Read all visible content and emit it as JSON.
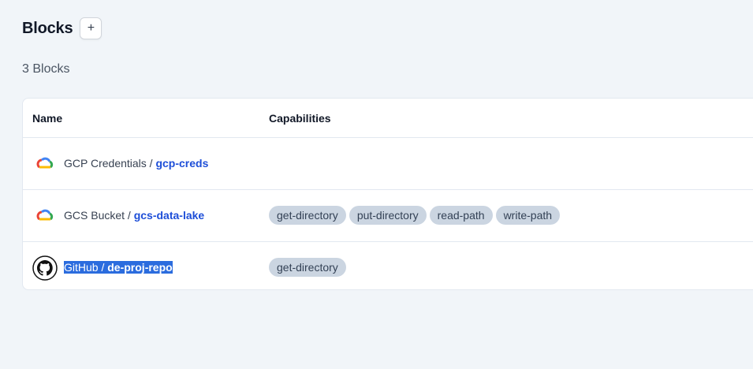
{
  "header": {
    "title": "Blocks",
    "add_label": "+"
  },
  "count_text": "3 Blocks",
  "table": {
    "columns": [
      "Name",
      "Capabilities"
    ],
    "rows": [
      {
        "logo": "google-cloud-icon",
        "type": "GCP Credentials",
        "separator": " / ",
        "slug": "gcp-creds",
        "capabilities": []
      },
      {
        "logo": "google-cloud-icon",
        "type": "GCS Bucket",
        "separator": " / ",
        "slug": "gcs-data-lake",
        "capabilities": [
          "get-directory",
          "put-directory",
          "read-path",
          "write-path"
        ]
      },
      {
        "logo": "github-icon",
        "type": "GitHub",
        "separator": " / ",
        "slug": "de-proj-repo",
        "capabilities": [
          "get-directory"
        ],
        "selected": true
      }
    ]
  },
  "colors": {
    "background": "#f1f5f9",
    "link": "#1d4ed8",
    "pill": "#cbd5e1",
    "selection": "#2b6cde"
  }
}
